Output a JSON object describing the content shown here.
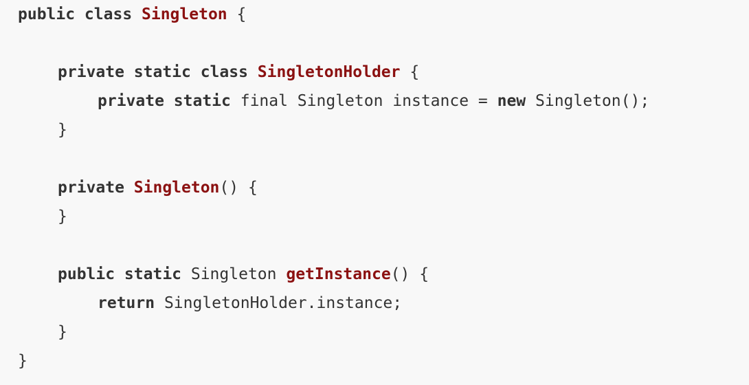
{
  "code": {
    "lines": [
      {
        "indent": 0,
        "tokens": [
          {
            "t": "kw",
            "v": "public class "
          },
          {
            "t": "title",
            "v": "Singleton"
          },
          {
            "t": "plain",
            "v": " {"
          }
        ]
      },
      {
        "indent": 0,
        "tokens": []
      },
      {
        "indent": 1,
        "tokens": [
          {
            "t": "kw",
            "v": "private static class "
          },
          {
            "t": "title",
            "v": "SingletonHolder"
          },
          {
            "t": "plain",
            "v": " {"
          }
        ]
      },
      {
        "indent": 2,
        "tokens": [
          {
            "t": "kw",
            "v": "private static"
          },
          {
            "t": "plain",
            "v": " final Singleton instance = "
          },
          {
            "t": "kw",
            "v": "new"
          },
          {
            "t": "plain",
            "v": " Singleton();"
          }
        ]
      },
      {
        "indent": 1,
        "tokens": [
          {
            "t": "plain",
            "v": "}"
          }
        ]
      },
      {
        "indent": 0,
        "tokens": []
      },
      {
        "indent": 1,
        "tokens": [
          {
            "t": "kw",
            "v": "private "
          },
          {
            "t": "title",
            "v": "Singleton"
          },
          {
            "t": "plain",
            "v": "() {"
          }
        ]
      },
      {
        "indent": 1,
        "tokens": [
          {
            "t": "plain",
            "v": "}"
          }
        ]
      },
      {
        "indent": 0,
        "tokens": []
      },
      {
        "indent": 1,
        "tokens": [
          {
            "t": "kw",
            "v": "public static"
          },
          {
            "t": "plain",
            "v": " Singleton "
          },
          {
            "t": "title",
            "v": "getInstance"
          },
          {
            "t": "plain",
            "v": "() {"
          }
        ]
      },
      {
        "indent": 2,
        "tokens": [
          {
            "t": "kw",
            "v": "return"
          },
          {
            "t": "plain",
            "v": " SingletonHolder.instance;"
          }
        ]
      },
      {
        "indent": 1,
        "tokens": [
          {
            "t": "plain",
            "v": "}"
          }
        ]
      },
      {
        "indent": 0,
        "tokens": [
          {
            "t": "plain",
            "v": "}"
          }
        ]
      }
    ]
  },
  "colors": {
    "background": "#f8f8f8",
    "text": "#333333",
    "title": "#8b1111"
  }
}
